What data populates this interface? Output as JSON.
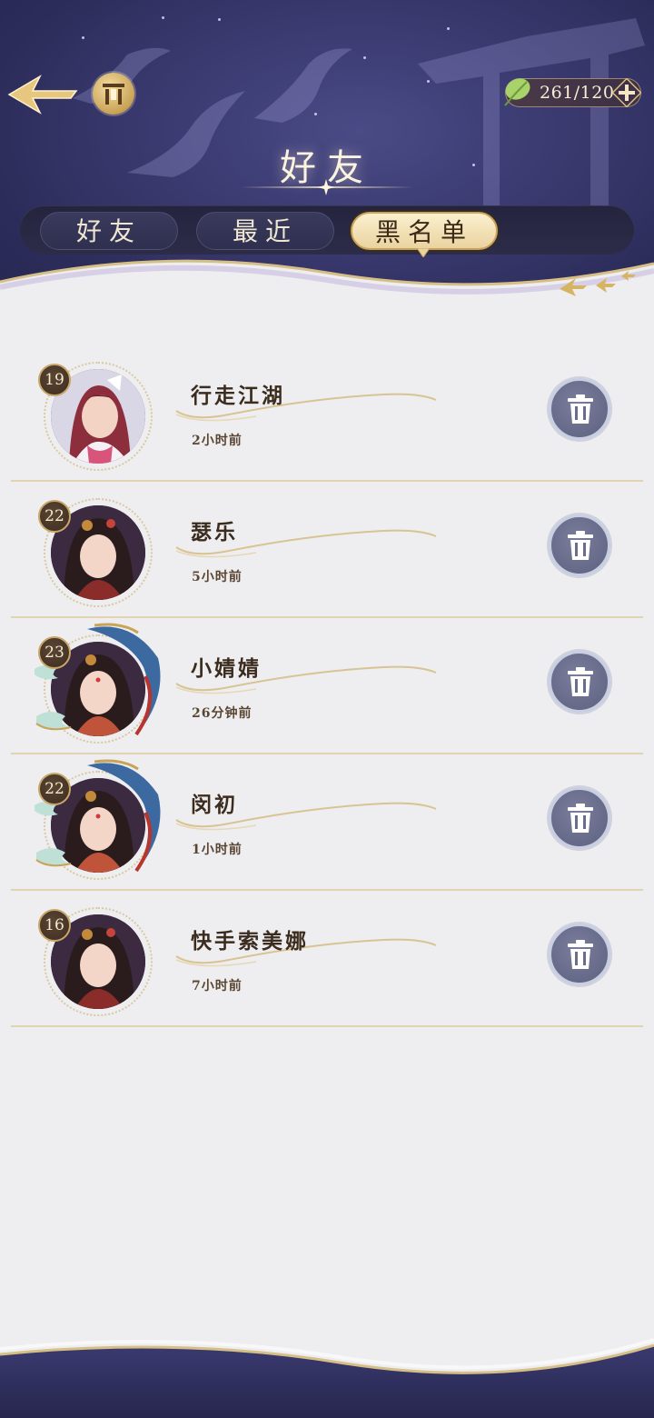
{
  "header": {
    "title": "好友",
    "resource": {
      "value": "261/120",
      "icon": "leaf-icon"
    },
    "tabs": [
      {
        "label": "好友",
        "active": false
      },
      {
        "label": "最近",
        "active": false
      },
      {
        "label": "黑名单",
        "active": true
      }
    ]
  },
  "blacklist": [
    {
      "name": "行走江湖",
      "level": "19",
      "time": "2小时前",
      "frame": "plain"
    },
    {
      "name": "瑟乐",
      "level": "22",
      "time": "5小时前",
      "frame": "plain"
    },
    {
      "name": "小婧婧",
      "level": "23",
      "time": "26分钟前",
      "frame": "phoenix"
    },
    {
      "name": "闵初",
      "level": "22",
      "time": "1小时前",
      "frame": "phoenix"
    },
    {
      "name": "快手索美娜",
      "level": "16",
      "time": "7小时前",
      "frame": "plain"
    }
  ],
  "colors": {
    "header_bg": "#33336a",
    "gold": "#c9a356",
    "list_bg": "#eeeef1",
    "trash_button": "#6a6e8c"
  }
}
